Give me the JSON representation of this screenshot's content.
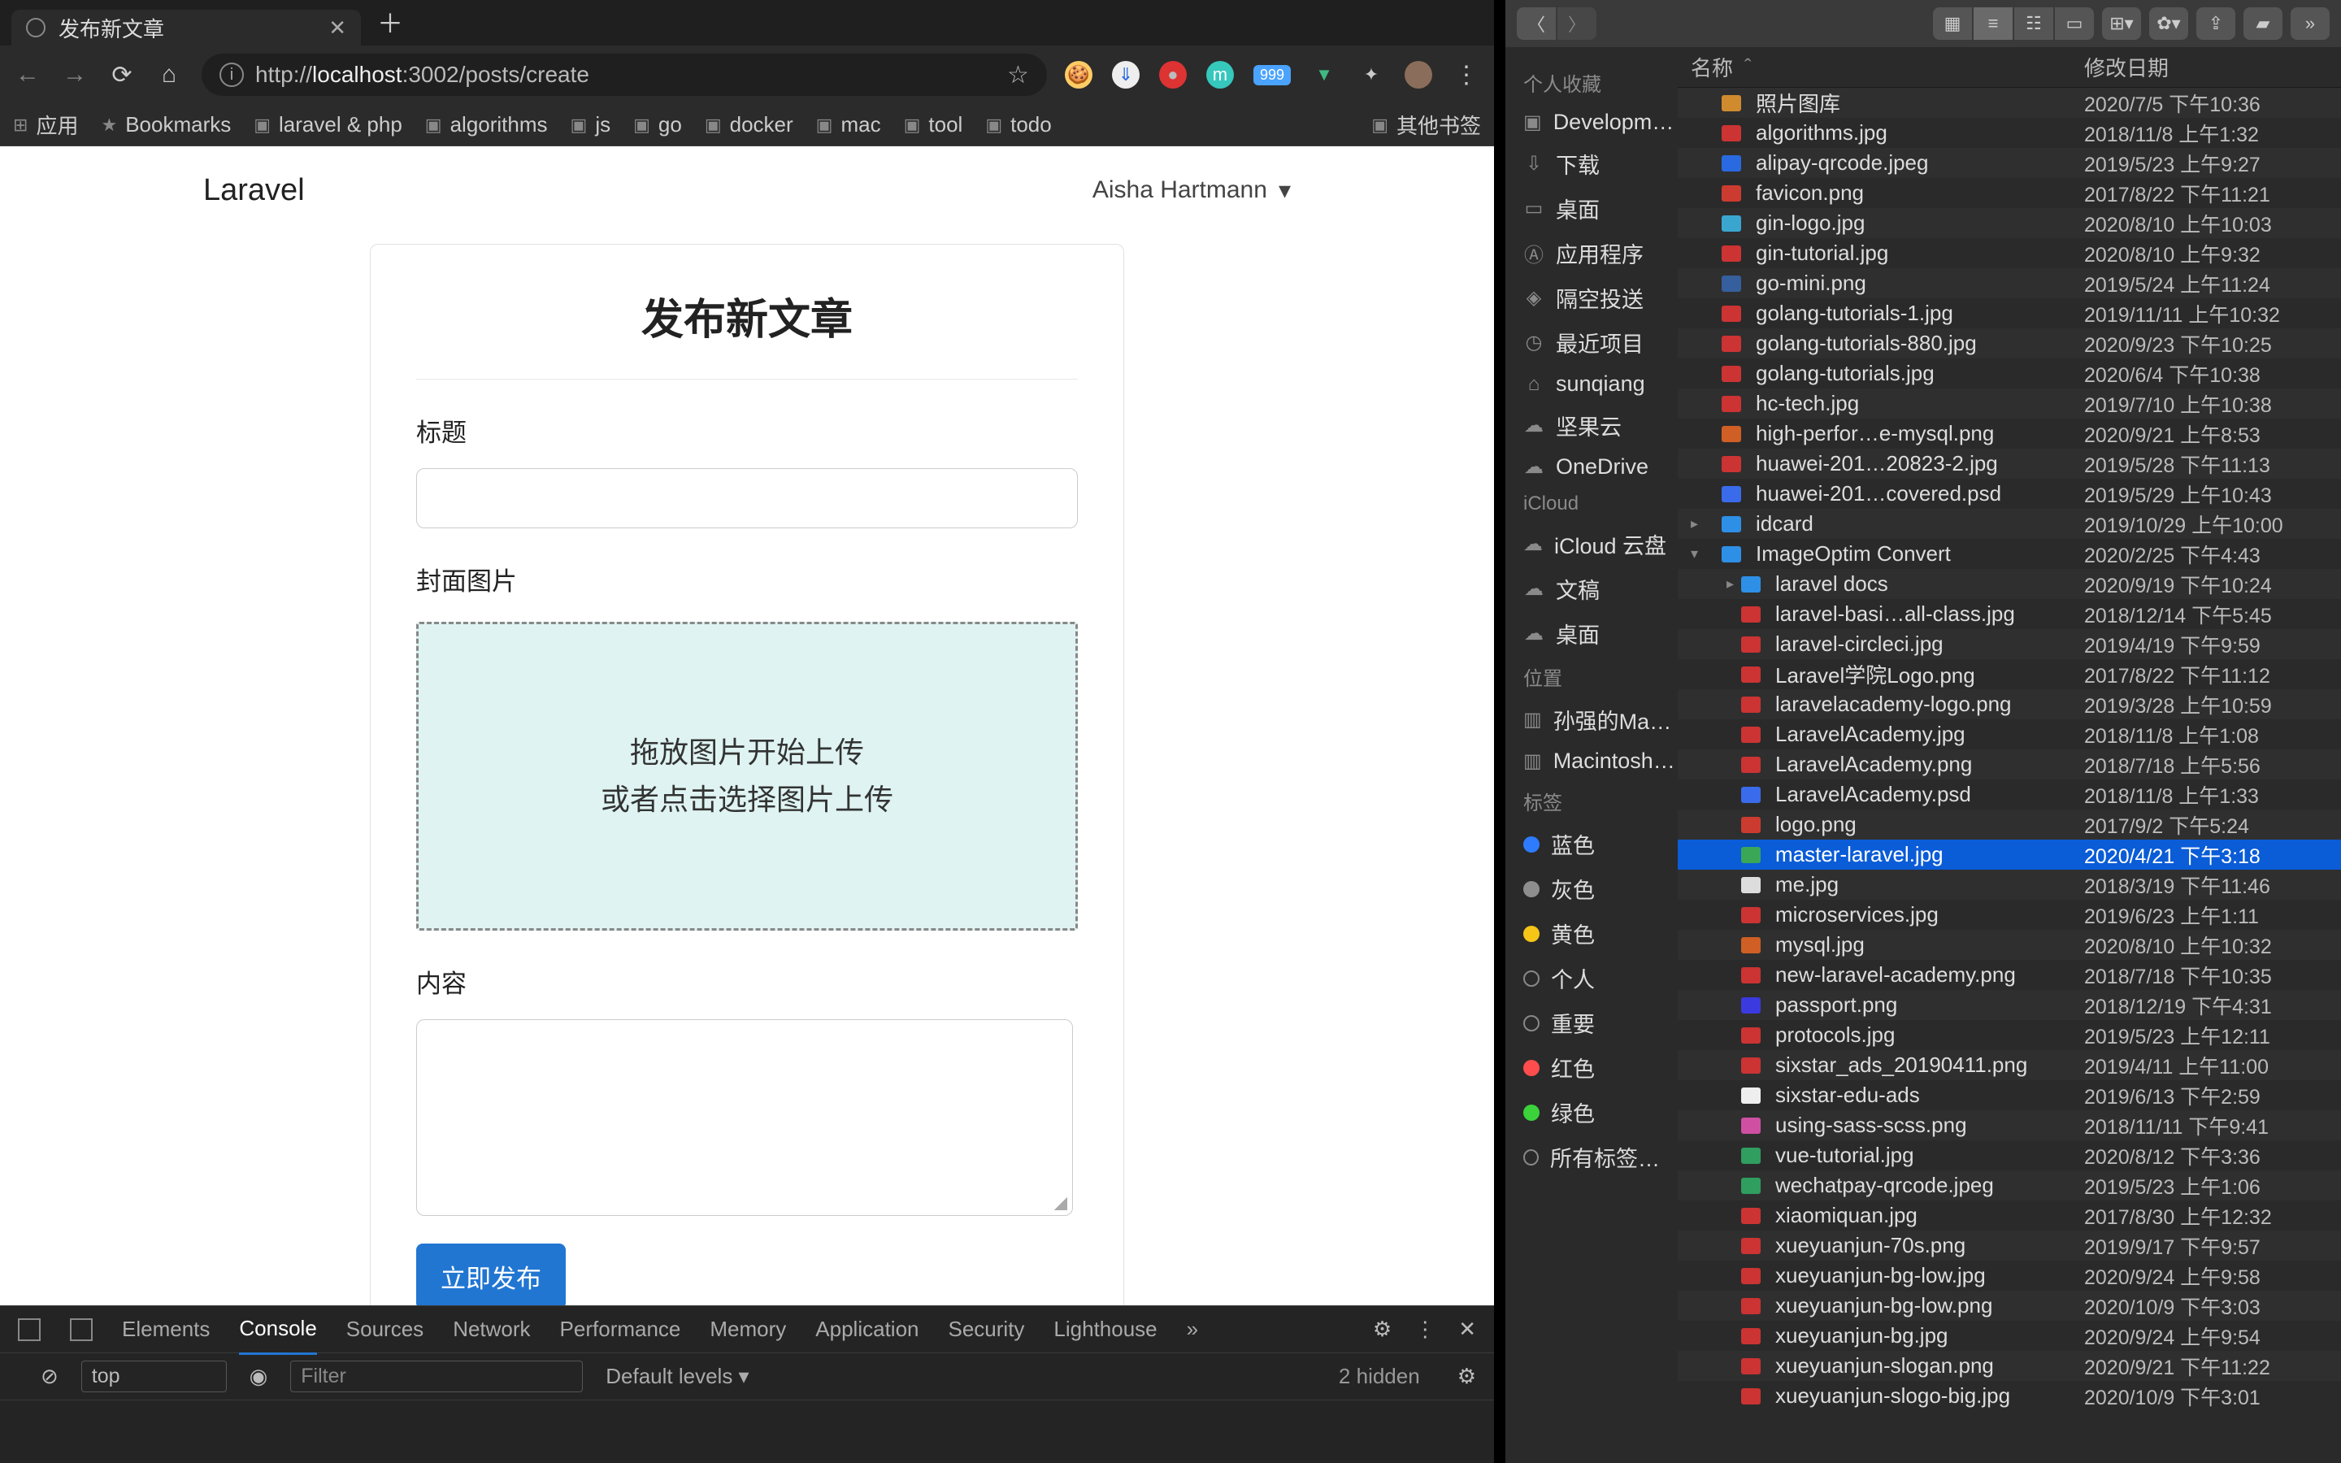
{
  "browser": {
    "tab_title": "发布新文章",
    "url_prefix": "http://",
    "url_host": "localhost",
    "url_rest": ":3002/posts/create",
    "bookmarks": [
      "应用",
      "Bookmarks",
      "laravel & php",
      "algorithms",
      "js",
      "go",
      "docker",
      "mac",
      "tool",
      "todo"
    ],
    "other_bookmarks": "其他书签",
    "ext_badge": "999"
  },
  "page": {
    "brand": "Laravel",
    "user": "Aisha Hartmann",
    "title": "发布新文章",
    "label_title": "标题",
    "label_cover": "封面图片",
    "drop_line1": "拖放图片开始上传",
    "drop_line2": "或者点击选择图片上传",
    "label_content": "内容",
    "submit": "立即发布"
  },
  "devtools": {
    "tabs": [
      "Elements",
      "Console",
      "Sources",
      "Network",
      "Performance",
      "Memory",
      "Application",
      "Security",
      "Lighthouse"
    ],
    "active_tab": "Console",
    "context": "top",
    "filter_placeholder": "Filter",
    "levels": "Default levels",
    "hidden": "2 hidden"
  },
  "finder": {
    "cols": {
      "name": "名称",
      "modified": "修改日期"
    },
    "sidebar": {
      "fav_header": "个人收藏",
      "favorites": [
        "Developm…",
        "下载",
        "桌面",
        "应用程序",
        "隔空投送",
        "最近项目",
        "sunqiang",
        "坚果云",
        "OneDrive"
      ],
      "icloud_header": "iCloud",
      "icloud": [
        "iCloud 云盘",
        "文稿",
        "桌面"
      ],
      "loc_header": "位置",
      "locations": [
        "孙强的Ma…",
        "Macintosh…"
      ],
      "tag_header": "标签",
      "tags": [
        {
          "name": "蓝色",
          "color": "#2e7bff"
        },
        {
          "name": "灰色",
          "color": "#8e8e8e"
        },
        {
          "name": "黄色",
          "color": "#f5c518"
        },
        {
          "name": "个人",
          "color": "transparent"
        },
        {
          "name": "重要",
          "color": "transparent"
        },
        {
          "name": "红色",
          "color": "#ff4d4d"
        },
        {
          "name": "绿色",
          "color": "#3bd23b"
        },
        {
          "name": "所有标签…",
          "color": "transparent"
        }
      ]
    },
    "files": [
      {
        "tri": "",
        "ic": "#d08b2f",
        "name": "照片图库",
        "date": "2020/7/5 下午10:36"
      },
      {
        "tri": "",
        "ic": "#c33",
        "name": "algorithms.jpg",
        "date": "2018/11/8 上午1:32"
      },
      {
        "tri": "",
        "ic": "#2a6ae0",
        "name": "alipay-qrcode.jpeg",
        "date": "2019/5/23 上午9:27"
      },
      {
        "tri": "",
        "ic": "#cc3b2f",
        "name": "favicon.png",
        "date": "2017/8/22 下午11:21"
      },
      {
        "tri": "",
        "ic": "#3aa6d0",
        "name": "gin-logo.jpg",
        "date": "2020/8/10 上午10:03"
      },
      {
        "tri": "",
        "ic": "#c33",
        "name": "gin-tutorial.jpg",
        "date": "2020/8/10 上午9:32"
      },
      {
        "tri": "",
        "ic": "#365f9e",
        "name": "go-mini.png",
        "date": "2019/5/24 上午11:24"
      },
      {
        "tri": "",
        "ic": "#c33",
        "name": "golang-tutorials-1.jpg",
        "date": "2019/11/11 上午10:32"
      },
      {
        "tri": "",
        "ic": "#c33",
        "name": "golang-tutorials-880.jpg",
        "date": "2020/9/23 下午10:25"
      },
      {
        "tri": "",
        "ic": "#c33",
        "name": "golang-tutorials.jpg",
        "date": "2020/6/4 下午10:38"
      },
      {
        "tri": "",
        "ic": "#c33",
        "name": "hc-tech.jpg",
        "date": "2019/7/10 上午10:38"
      },
      {
        "tri": "",
        "ic": "#cf5f25",
        "name": "high-perfor…e-mysql.png",
        "date": "2020/9/21 上午8:53"
      },
      {
        "tri": "",
        "ic": "#c33",
        "name": "huawei-201…20823-2.jpg",
        "date": "2019/5/28 下午11:13"
      },
      {
        "tri": "",
        "ic": "#3a6bea",
        "name": "huawei-201…covered.psd",
        "date": "2019/5/29 上午10:43"
      },
      {
        "tri": "▸",
        "ic": "#2e8fe6",
        "name": "idcard",
        "date": "2019/10/29 上午10:00",
        "folder": true
      },
      {
        "tri": "▾",
        "ic": "#2e8fe6",
        "name": "ImageOptim Convert",
        "date": "2020/2/25 下午4:43",
        "folder": true
      },
      {
        "tri": "▸",
        "ic": "#2e8fe6",
        "name": "laravel docs",
        "date": "2020/9/19 下午10:24",
        "folder": true,
        "indent": true
      },
      {
        "tri": "",
        "ic": "#c33",
        "name": "laravel-basi…all-class.jpg",
        "date": "2018/12/14 下午5:45",
        "indent": true
      },
      {
        "tri": "",
        "ic": "#c33",
        "name": "laravel-circleci.jpg",
        "date": "2019/4/19 下午9:59",
        "indent": true
      },
      {
        "tri": "",
        "ic": "#c33",
        "name": "Laravel学院Logo.png",
        "date": "2017/8/22 下午11:12",
        "indent": true
      },
      {
        "tri": "",
        "ic": "#c33",
        "name": "laravelacademy-logo.png",
        "date": "2019/3/28 上午10:59",
        "indent": true
      },
      {
        "tri": "",
        "ic": "#c33",
        "name": "LaravelAcademy.jpg",
        "date": "2018/11/8 上午1:08",
        "indent": true
      },
      {
        "tri": "",
        "ic": "#c33",
        "name": "LaravelAcademy.png",
        "date": "2018/7/18 上午5:56",
        "indent": true
      },
      {
        "tri": "",
        "ic": "#3a6bea",
        "name": "LaravelAcademy.psd",
        "date": "2018/11/8 上午1:33",
        "indent": true
      },
      {
        "tri": "",
        "ic": "#cc3b2f",
        "name": "logo.png",
        "date": "2017/9/2 下午5:24",
        "indent": true
      },
      {
        "tri": "",
        "ic": "#3aa757",
        "name": "master-laravel.jpg",
        "date": "2020/4/21 下午3:18",
        "indent": true,
        "selected": true
      },
      {
        "tri": "",
        "ic": "#ddd",
        "name": "me.jpg",
        "date": "2018/3/19 下午11:46",
        "indent": true
      },
      {
        "tri": "",
        "ic": "#c33",
        "name": "microservices.jpg",
        "date": "2019/6/23 上午1:11",
        "indent": true
      },
      {
        "tri": "",
        "ic": "#cf5f25",
        "name": "mysql.jpg",
        "date": "2020/8/10 上午10:32",
        "indent": true
      },
      {
        "tri": "",
        "ic": "#c33",
        "name": "new-laravel-academy.png",
        "date": "2018/7/18 下午10:35",
        "indent": true
      },
      {
        "tri": "",
        "ic": "#3a3adf",
        "name": "passport.png",
        "date": "2018/12/19 下午4:31",
        "indent": true
      },
      {
        "tri": "",
        "ic": "#c33",
        "name": "protocols.jpg",
        "date": "2019/5/23 上午12:11",
        "indent": true
      },
      {
        "tri": "",
        "ic": "#c33",
        "name": "sixstar_ads_20190411.png",
        "date": "2019/4/11 上午11:00",
        "indent": true
      },
      {
        "tri": "",
        "ic": "#eee",
        "name": "sixstar-edu-ads",
        "date": "2019/6/13 下午2:59",
        "indent": true
      },
      {
        "tri": "",
        "ic": "#cf4fa3",
        "name": "using-sass-scss.png",
        "date": "2018/11/11 下午9:41",
        "indent": true
      },
      {
        "tri": "",
        "ic": "#2f9e5f",
        "name": "vue-tutorial.jpg",
        "date": "2020/8/12 下午3:36",
        "indent": true
      },
      {
        "tri": "",
        "ic": "#2f9e5f",
        "name": "wechatpay-qrcode.jpeg",
        "date": "2019/5/23 上午1:06",
        "indent": true
      },
      {
        "tri": "",
        "ic": "#c33",
        "name": "xiaomiquan.jpg",
        "date": "2017/8/30 上午12:32",
        "indent": true
      },
      {
        "tri": "",
        "ic": "#c33",
        "name": "xueyuanjun-70s.png",
        "date": "2019/9/17 下午9:57",
        "indent": true
      },
      {
        "tri": "",
        "ic": "#c33",
        "name": "xueyuanjun-bg-low.jpg",
        "date": "2020/9/24 上午9:58",
        "indent": true
      },
      {
        "tri": "",
        "ic": "#c33",
        "name": "xueyuanjun-bg-low.png",
        "date": "2020/10/9 下午3:03",
        "indent": true
      },
      {
        "tri": "",
        "ic": "#c33",
        "name": "xueyuanjun-bg.jpg",
        "date": "2020/9/24 上午9:54",
        "indent": true
      },
      {
        "tri": "",
        "ic": "#c33",
        "name": "xueyuanjun-slogan.png",
        "date": "2020/9/21 下午11:22",
        "indent": true
      },
      {
        "tri": "",
        "ic": "#c33",
        "name": "xueyuanjun-slogo-big.jpg",
        "date": "2020/10/9 下午3:01",
        "indent": true
      }
    ]
  }
}
